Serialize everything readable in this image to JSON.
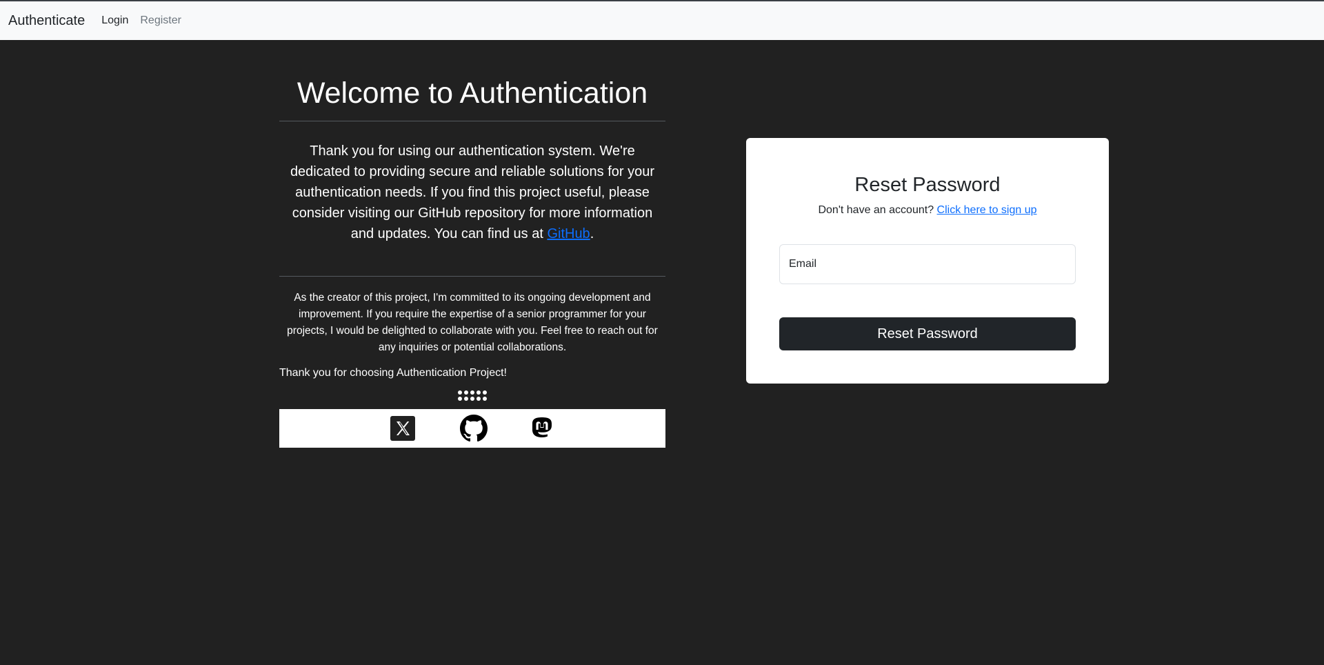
{
  "navbar": {
    "brand": "Authenticate",
    "links": [
      "Login",
      "Register"
    ]
  },
  "welcome": {
    "title": "Welcome to Authentication",
    "intro_text": "Thank you for using our authentication system. We're dedicated to providing secure and reliable solutions for your authentication needs. If you find this project useful, please consider visiting our GitHub repository for more information and updates. You can find us at",
    "github_link": "GitHub",
    "intro_end": ".",
    "creator_text": "As the creator of this project, I'm committed to its ongoing development and improvement. If you require the expertise of a senior programmer for your projects, I would be delighted to collaborate with you. Feel free to reach out for any inquiries or potential collaborations.",
    "thanks": "Thank you for choosing Authentication Project!"
  },
  "social_icons": [
    "x-icon",
    "github-icon",
    "mastodon-icon"
  ],
  "reset_card": {
    "title": "Reset Password",
    "signup_prompt": "Don't have an account?",
    "signup_link": "Click here to sign up",
    "email_placeholder": "Email",
    "button_label": "Reset Password"
  },
  "colors": {
    "background": "#212121",
    "navbar": "#f8f9fa",
    "link": "#0d6efd",
    "button": "#212529"
  }
}
